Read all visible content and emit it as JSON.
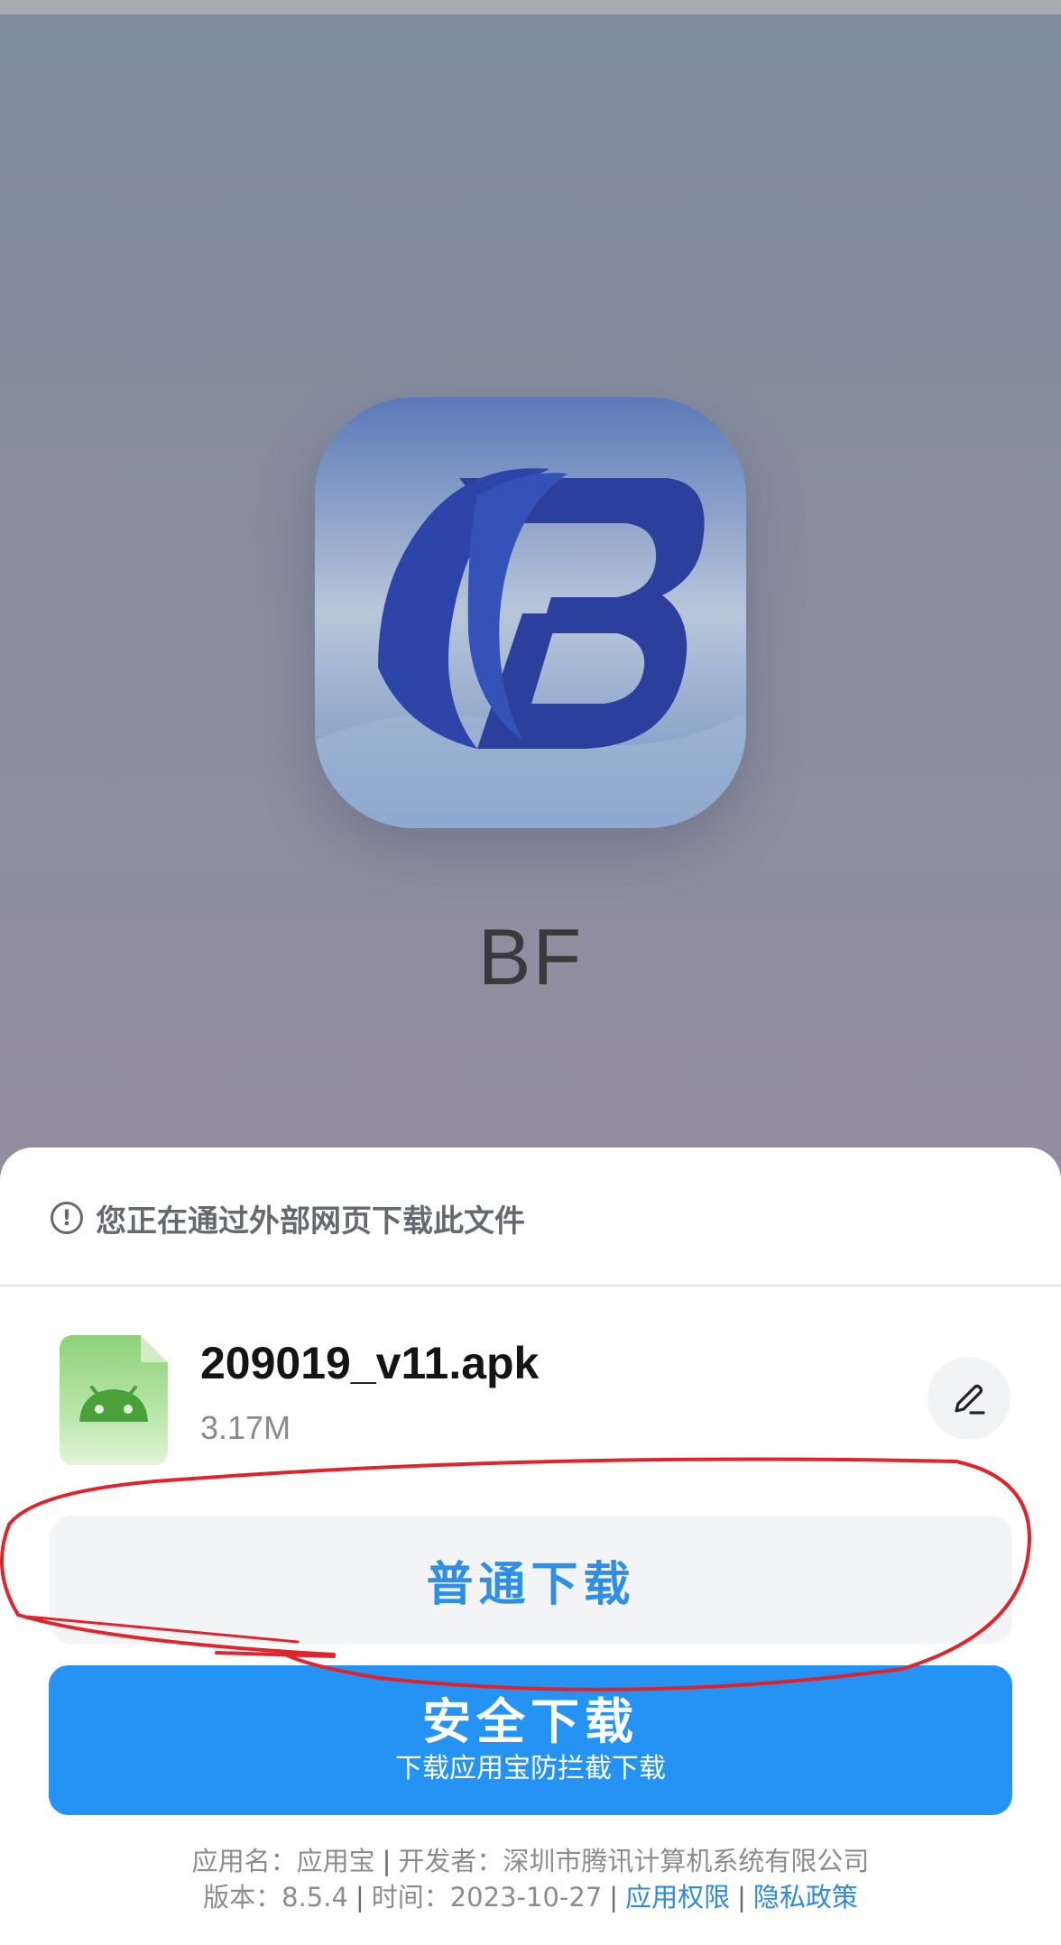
{
  "app": {
    "name": "BF"
  },
  "sheet": {
    "warning_text": "您正在通过外部网页下载此文件",
    "warning_icon_glyph": "!",
    "file": {
      "name": "209019_v11.apk",
      "size": "3.17M",
      "icon": "android-apk-icon"
    },
    "edit_icon": "pencil-icon",
    "normal_download_label": "普通下载",
    "safe_download_label": "安全下载",
    "safe_download_sub": "下载应用宝防拦截下载"
  },
  "footer": {
    "app_name_label": "应用名：",
    "app_name": "应用宝",
    "developer_label": "开发者：",
    "developer": "深圳市腾讯计算机系统有限公司",
    "version_label": "版本：",
    "version": "8.5.4",
    "time_label": "时间：",
    "time": "2023-10-27",
    "permissions_link": "应用权限",
    "privacy_link": "隐私政策",
    "separator": "|"
  },
  "colors": {
    "accent": "#2493f3",
    "link": "#2e88dc",
    "annotation_red": "#e0242c"
  }
}
